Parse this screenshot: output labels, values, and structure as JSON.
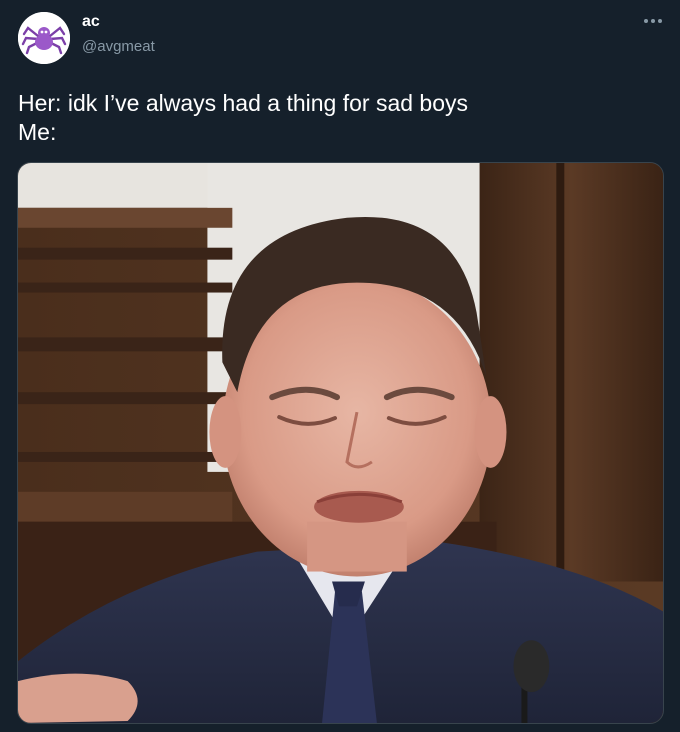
{
  "tweet": {
    "author": {
      "display_name": "ac",
      "handle": "@avgmeat",
      "avatar_icon": "purple-spider-avatar"
    },
    "more_icon": "more-options-icon",
    "text_lines": [
      "Her: idk I’ve always had a thing for sad boys",
      "Me:"
    ],
    "media": {
      "type": "photo",
      "subject_icon": "crying-man-photo"
    }
  },
  "colors": {
    "background": "#15202b",
    "text_primary": "#ffffff",
    "text_secondary": "#8899a6",
    "border": "#38444d"
  }
}
